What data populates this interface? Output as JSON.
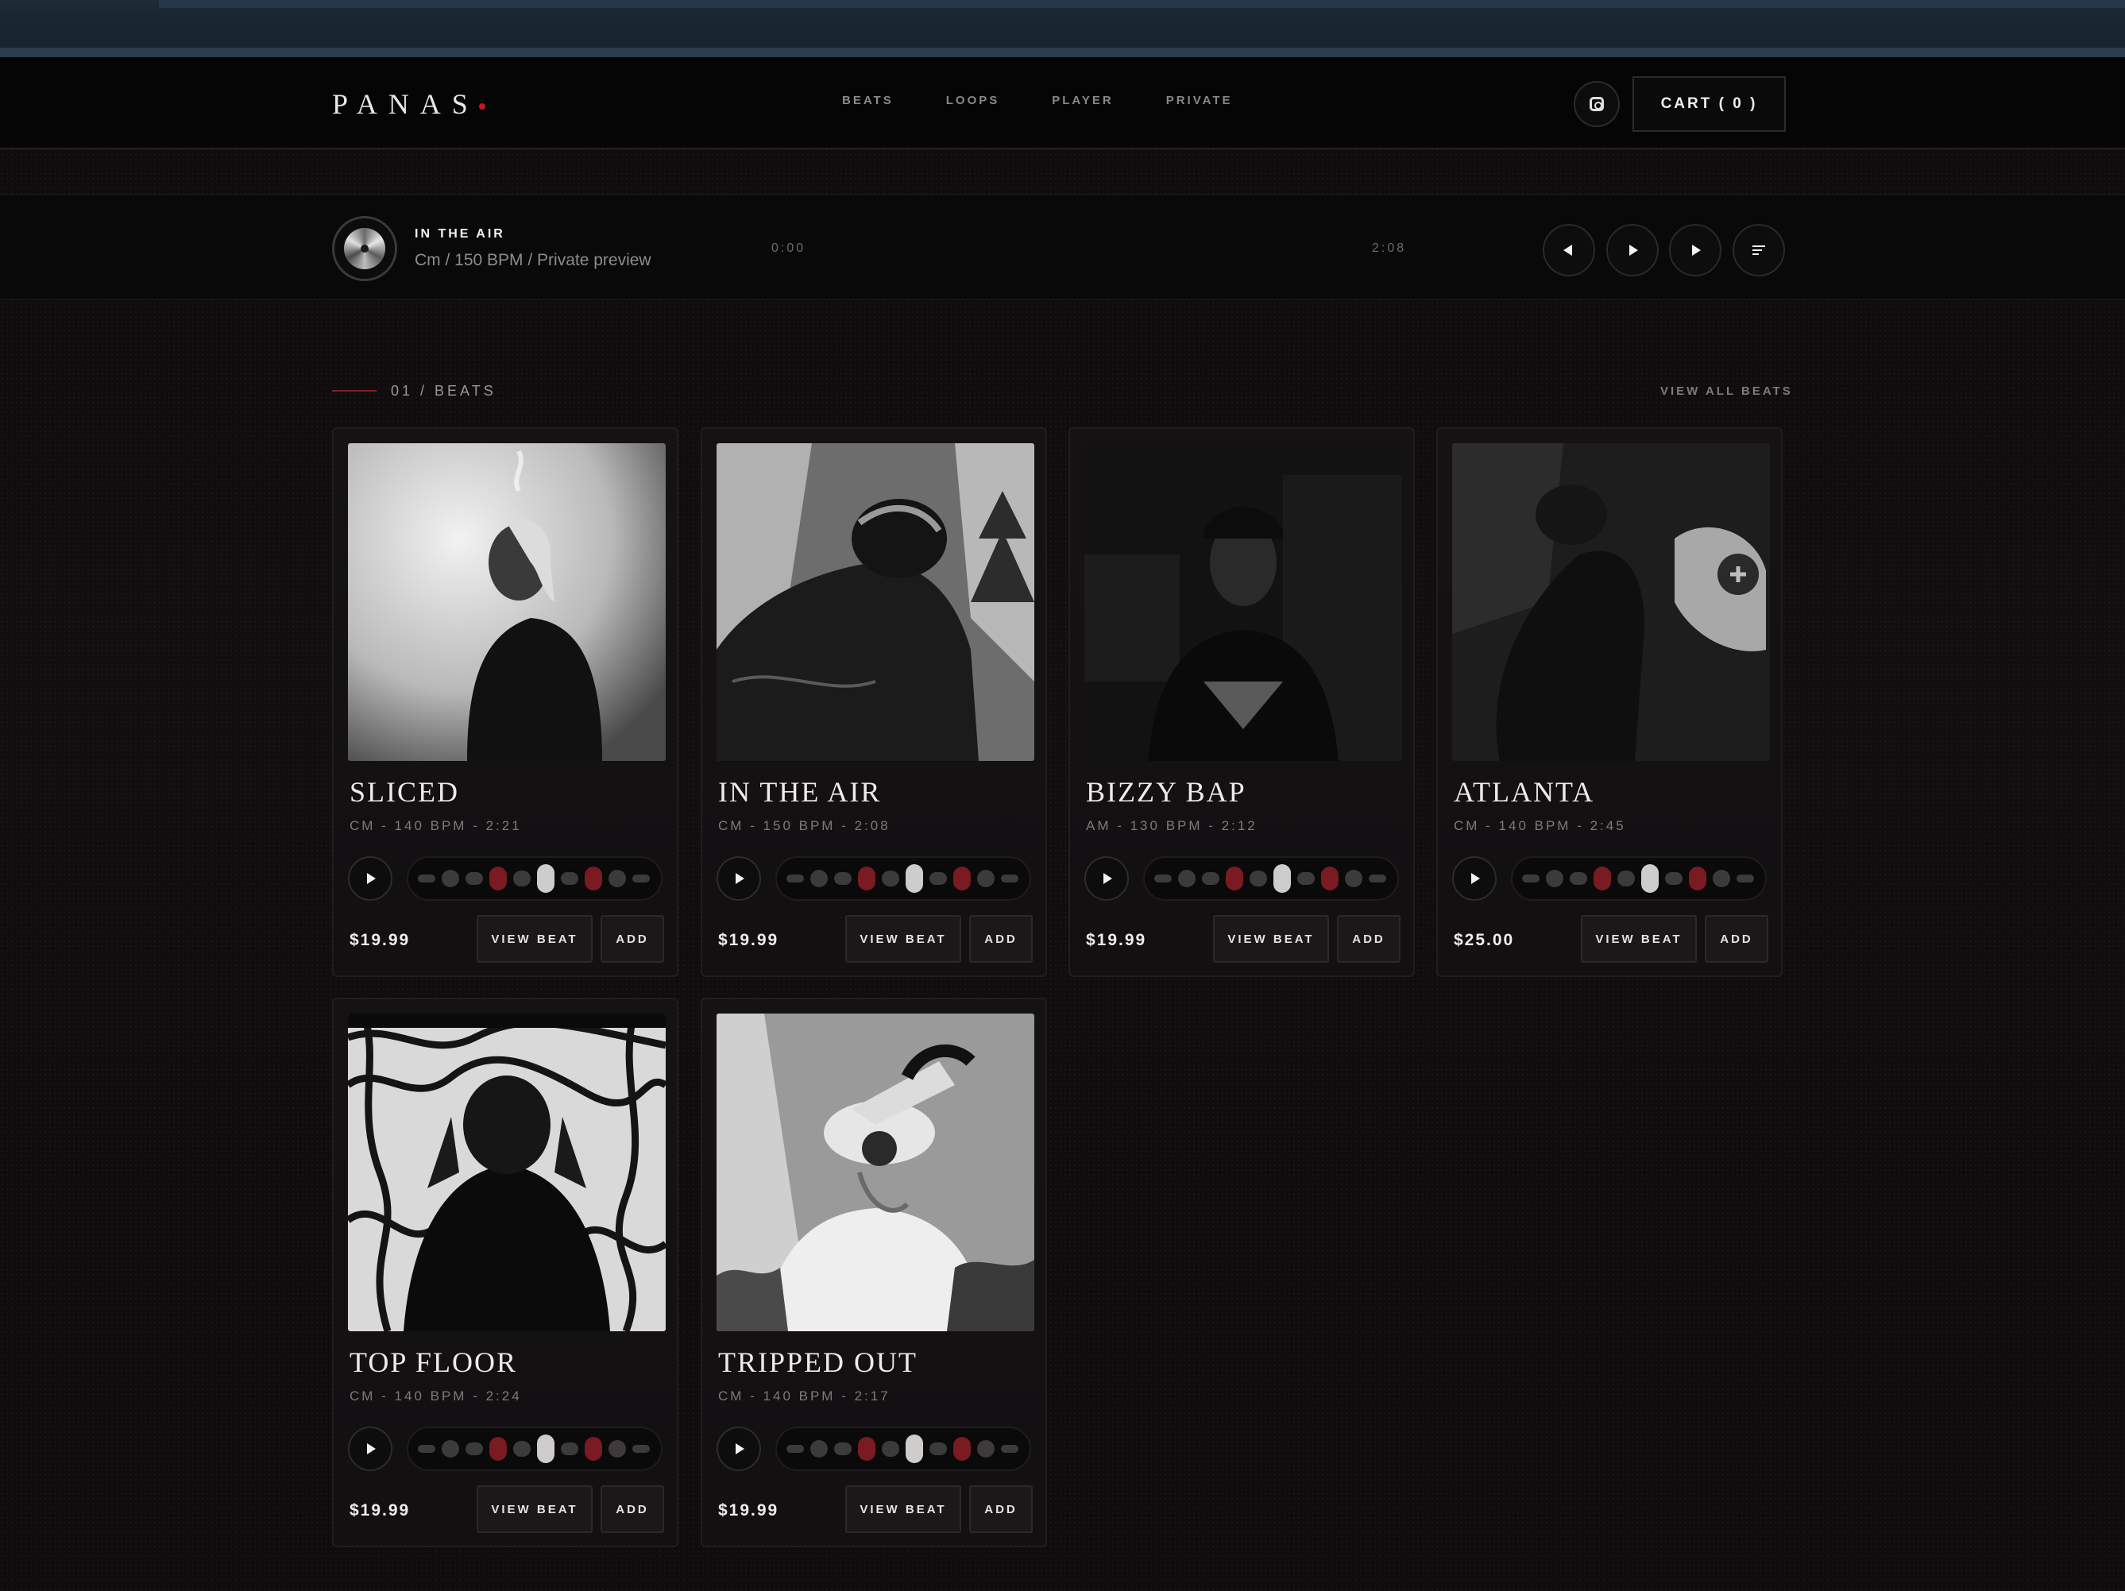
{
  "brand": {
    "logo": "PANAS",
    "accent": "#c0182a"
  },
  "nav": {
    "items": [
      "BEATS",
      "LOOPS",
      "PLAYER",
      "PRIVATE"
    ]
  },
  "header": {
    "instagram_icon": "instagram-icon",
    "cart_label": "CART ( 0 )"
  },
  "player": {
    "title": "IN THE AIR",
    "meta": "Cm / 150 BPM / Private preview",
    "time_start": "0:00",
    "time_end": "2:08",
    "controls": [
      "prev-icon",
      "play-icon",
      "next-icon",
      "queue-icon"
    ]
  },
  "section": {
    "label": "01 / BEATS",
    "view_all": "VIEW ALL BEATS"
  },
  "beats": [
    {
      "title": "SLICED",
      "meta": "CM - 140 BPM - 2:21",
      "price": "$19.99",
      "view_label": "VIEW BEAT",
      "add_label": "ADD"
    },
    {
      "title": "IN THE AIR",
      "meta": "CM - 150 BPM - 2:08",
      "price": "$19.99",
      "view_label": "VIEW BEAT",
      "add_label": "ADD"
    },
    {
      "title": "BIZZY BAP",
      "meta": "AM - 130 BPM - 2:12",
      "price": "$19.99",
      "view_label": "VIEW BEAT",
      "add_label": "ADD"
    },
    {
      "title": "ATLANTA",
      "meta": "CM - 140 BPM - 2:45",
      "price": "$25.00",
      "view_label": "VIEW BEAT",
      "add_label": "ADD"
    },
    {
      "title": "TOP FLOOR",
      "meta": "CM - 140 BPM - 2:24",
      "price": "$19.99",
      "view_label": "VIEW BEAT",
      "add_label": "ADD"
    },
    {
      "title": "TRIPPED OUT",
      "meta": "CM - 140 BPM - 2:17",
      "price": "$19.99",
      "view_label": "VIEW BEAT",
      "add_label": "ADD"
    }
  ]
}
